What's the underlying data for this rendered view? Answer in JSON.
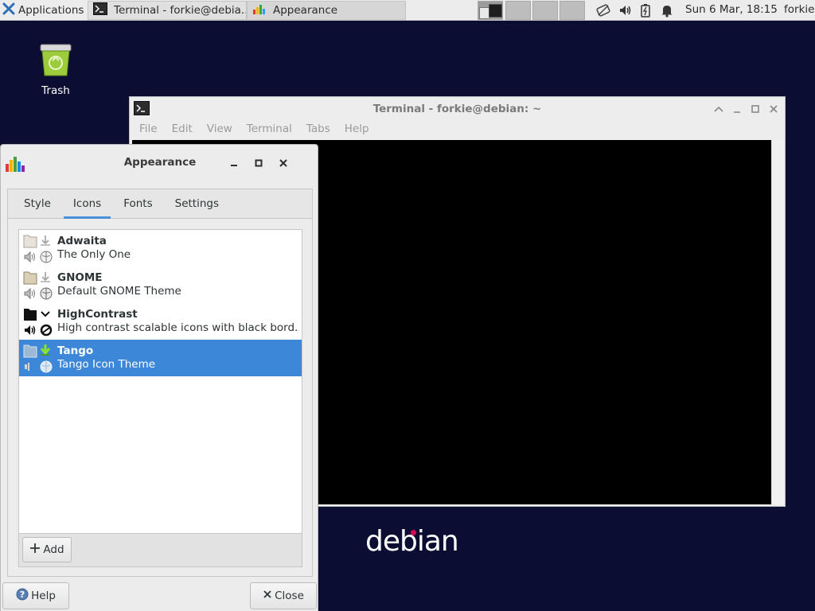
{
  "panel": {
    "applications_label": "Applications",
    "tasks": [
      {
        "label": "Terminal - forkie@debia..."
      },
      {
        "label": "Appearance"
      }
    ],
    "clock": "Sun  6 Mar, 18:15",
    "user": "forkie"
  },
  "desktop": {
    "trash_label": "Trash",
    "logo_text": "debian"
  },
  "terminal": {
    "title": "Terminal - forkie@debian: ~",
    "menu": [
      "File",
      "Edit",
      "View",
      "Terminal",
      "Tabs",
      "Help"
    ]
  },
  "appearance": {
    "title": "Appearance",
    "tabs": [
      "Style",
      "Icons",
      "Fonts",
      "Settings"
    ],
    "active_tab": "Icons",
    "themes": [
      {
        "name": "Adwaita",
        "desc": "The Only One"
      },
      {
        "name": "GNOME",
        "desc": "Default GNOME Theme"
      },
      {
        "name": "HighContrast",
        "desc": "High contrast scalable icons with black bord..."
      },
      {
        "name": "Tango",
        "desc": "Tango Icon Theme"
      }
    ],
    "selected_theme": "Tango",
    "add_label": "Add",
    "help_label": "Help",
    "close_label": "Close"
  },
  "colors": {
    "desktop_bg": "#0c0d33",
    "selection": "#3d87d9",
    "tab_underline": "#4a90d9",
    "debian_red": "#d70a53"
  }
}
